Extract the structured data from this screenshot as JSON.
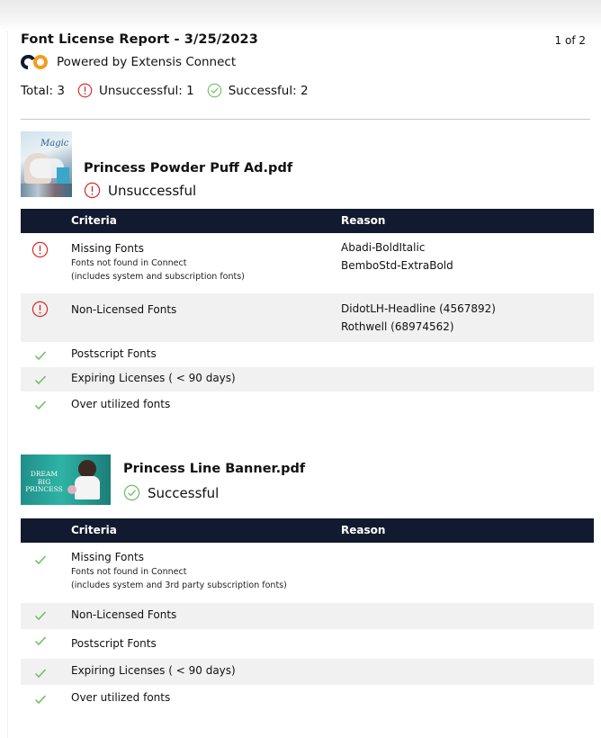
{
  "header": {
    "title": "Font License Report - 3/25/2023",
    "page": "1 of 2",
    "powered_by": "Powered by Extensis Connect"
  },
  "totals": {
    "total": "Total: 3",
    "unsuccessful": "Unsuccessful: 1",
    "successful": "Successful: 2"
  },
  "colors": {
    "error": "#d32f2f",
    "success": "#6abf5e",
    "table_header": "#121a2f",
    "logo_navy": "#121a2f",
    "logo_orange": "#f39c1f"
  },
  "columns": {
    "criteria": "Criteria",
    "reason": "Reason"
  },
  "documents": [
    {
      "name": "Princess Powder Puff Ad.pdf",
      "status": "Unsuccessful",
      "thumbnail_text": "Magic",
      "rows": [
        {
          "status": "error",
          "criteria": "Missing Fonts",
          "sub1": "Fonts not found in Connect",
          "sub2": "(includes system and subscription fonts)",
          "reasons": [
            "Abadi-BoldItalic",
            "BemboStd-ExtraBold"
          ]
        },
        {
          "status": "error",
          "criteria": "Non-Licensed Fonts",
          "reasons": [
            "DidotLH-Headline (4567892)",
            "Rothwell (68974562)"
          ]
        },
        {
          "status": "ok",
          "criteria": "Postscript Fonts"
        },
        {
          "status": "ok",
          "criteria": "Expiring Licenses ( < 90 days)"
        },
        {
          "status": "ok",
          "criteria": "Over utilized fonts"
        }
      ]
    },
    {
      "name": "Princess Line Banner.pdf",
      "status": "Successful",
      "thumbnail_text": "DREAM BIG PRINCESS",
      "rows": [
        {
          "status": "ok",
          "criteria": "Missing Fonts",
          "sub1": "Fonts not found in Connect",
          "sub2": "(includes system and 3rd party subscription fonts)"
        },
        {
          "status": "ok",
          "criteria": "Non-Licensed Fonts"
        },
        {
          "status": "ok",
          "criteria": "Postscript Fonts"
        },
        {
          "status": "ok",
          "criteria": "Expiring Licenses ( < 90 days)"
        },
        {
          "status": "ok",
          "criteria": "Over utilized fonts"
        }
      ]
    }
  ]
}
